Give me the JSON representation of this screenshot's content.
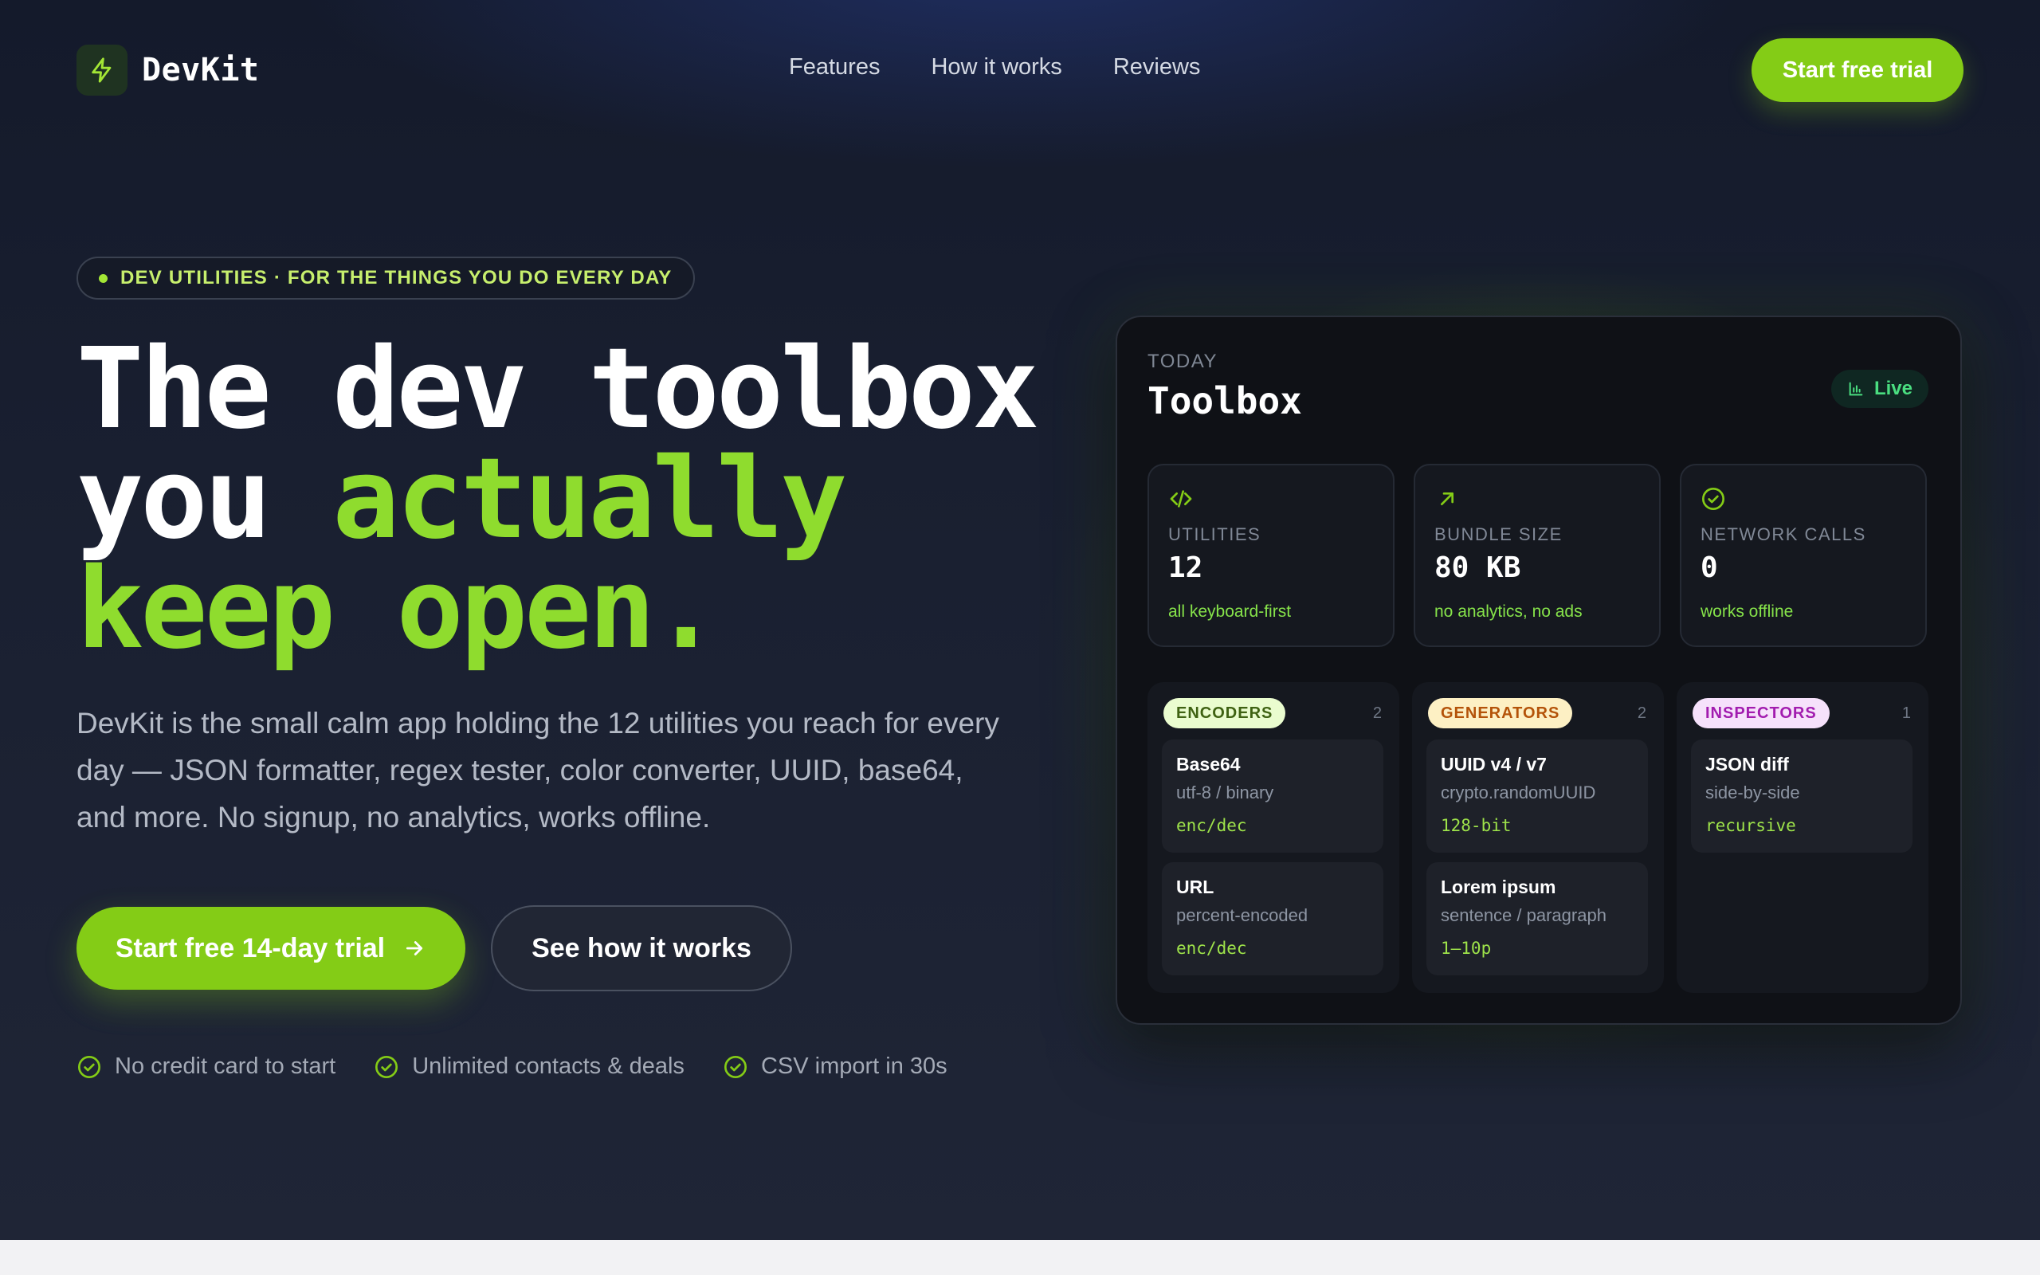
{
  "brand": {
    "name": "DevKit",
    "logo_icon": "bolt-icon",
    "accent": "#84cc16"
  },
  "nav": {
    "links": [
      "Features",
      "How it works",
      "Reviews"
    ],
    "cta": "Start free trial"
  },
  "hero": {
    "eyebrow": "DEV UTILITIES · FOR THE THINGS YOU DO EVERY DAY",
    "headline": {
      "line1": "The dev toolbox",
      "line2_plain": "you ",
      "line2_accent": "actually",
      "line3_accent": "keep open."
    },
    "lead": "DevKit is the small calm app holding the 12 utilities you reach for every day — JSON formatter, regex tester, color converter, UUID, base64, and more. No signup, no analytics, works offline.",
    "primary_cta": "Start free 14-day trial",
    "secondary_cta": "See how it works",
    "perks": [
      "No credit card to start",
      "Unlimited contacts & deals",
      "CSV import in 30s"
    ]
  },
  "dashboard": {
    "kicker": "TODAY",
    "title": "Toolbox",
    "live_label": "Live",
    "stats": [
      {
        "icon": "code-icon",
        "label": "UTILITIES",
        "value": "12",
        "sub": "all keyboard-first"
      },
      {
        "icon": "arrow-up-right-icon",
        "label": "BUNDLE SIZE",
        "value": "80 KB",
        "sub": "no analytics, no ads"
      },
      {
        "icon": "check-circle-icon",
        "label": "NETWORK CALLS",
        "value": "0",
        "sub": "works offline"
      }
    ],
    "columns": [
      {
        "tag": "ENCODERS",
        "count": "2",
        "tag_bg": "#eafccf",
        "tag_fg": "#3f6212",
        "tools": [
          {
            "name": "Base64",
            "desc": "utf-8 / binary",
            "code": "enc/dec"
          },
          {
            "name": "URL",
            "desc": "percent-encoded",
            "code": "enc/dec"
          }
        ]
      },
      {
        "tag": "GENERATORS",
        "count": "2",
        "tag_bg": "#fdf0c4",
        "tag_fg": "#b45309",
        "tools": [
          {
            "name": "UUID v4 / v7",
            "desc": "crypto.randomUUID",
            "code": "128-bit"
          },
          {
            "name": "Lorem ipsum",
            "desc": "sentence / paragraph",
            "code": "1–10p"
          }
        ]
      },
      {
        "tag": "INSPECTORS",
        "count": "1",
        "tag_bg": "#f6e1fb",
        "tag_fg": "#a21caf",
        "tools": [
          {
            "name": "JSON diff",
            "desc": "side-by-side",
            "code": "recursive"
          }
        ]
      }
    ]
  }
}
